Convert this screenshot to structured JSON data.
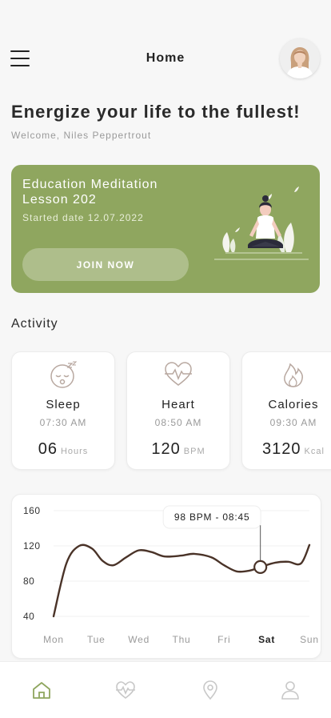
{
  "header": {
    "title": "Home",
    "menu_icon": "menu-icon",
    "avatar_icon": "avatar"
  },
  "greeting": {
    "headline": "Energize your life to the fullest!",
    "welcome": "Welcome, Niles Peppertrout"
  },
  "banner": {
    "title": "Education Meditation Lesson 202",
    "started": "Started date 12.07.2022",
    "button": "JOIN NOW",
    "color": "#8fa65f"
  },
  "activity": {
    "title": "Activity",
    "cards": [
      {
        "name": "Sleep",
        "time": "07:30 AM",
        "value": "06",
        "unit": "Hours",
        "icon": "sleep-icon"
      },
      {
        "name": "Heart",
        "time": "08:50 AM",
        "value": "120",
        "unit": "BPM",
        "icon": "heart-rate-icon"
      },
      {
        "name": "Calories",
        "time": "09:30 AM",
        "value": "3120",
        "unit": "Kcal",
        "icon": "flame-icon"
      }
    ]
  },
  "chart_data": {
    "type": "line",
    "categories": [
      "Mon",
      "Tue",
      "Wed",
      "Thu",
      "Fri",
      "Sat",
      "Sun"
    ],
    "y_ticks": [
      "160",
      "120",
      "80",
      "40"
    ],
    "ylim": [
      40,
      160
    ],
    "grid": true,
    "selected_category": "Sat",
    "tooltip": "98 BPM - 08:45",
    "series": [
      {
        "values": [
          [
            0,
            40
          ],
          [
            0.3,
            100
          ],
          [
            0.6,
            120
          ],
          [
            0.9,
            117
          ],
          [
            1.15,
            103
          ],
          [
            1.4,
            98
          ],
          [
            1.7,
            107
          ],
          [
            2.0,
            115
          ],
          [
            2.3,
            113
          ],
          [
            2.6,
            108
          ],
          [
            3.0,
            109
          ],
          [
            3.3,
            111
          ],
          [
            3.7,
            107
          ],
          [
            4.0,
            98
          ],
          [
            4.3,
            91
          ],
          [
            4.6,
            92
          ],
          [
            4.85,
            96
          ],
          [
            5.2,
            101
          ],
          [
            5.5,
            102
          ],
          [
            5.8,
            100
          ],
          [
            6.0,
            121
          ]
        ]
      }
    ],
    "highlight_point": [
      4.85,
      96
    ],
    "line_color": "#4a3328"
  },
  "tabbar": {
    "items": [
      {
        "icon": "home-icon",
        "active": true
      },
      {
        "icon": "heart-rate-icon",
        "active": false
      },
      {
        "icon": "location-icon",
        "active": false
      },
      {
        "icon": "profile-icon",
        "active": false
      }
    ],
    "active_color": "#8fa65f"
  }
}
